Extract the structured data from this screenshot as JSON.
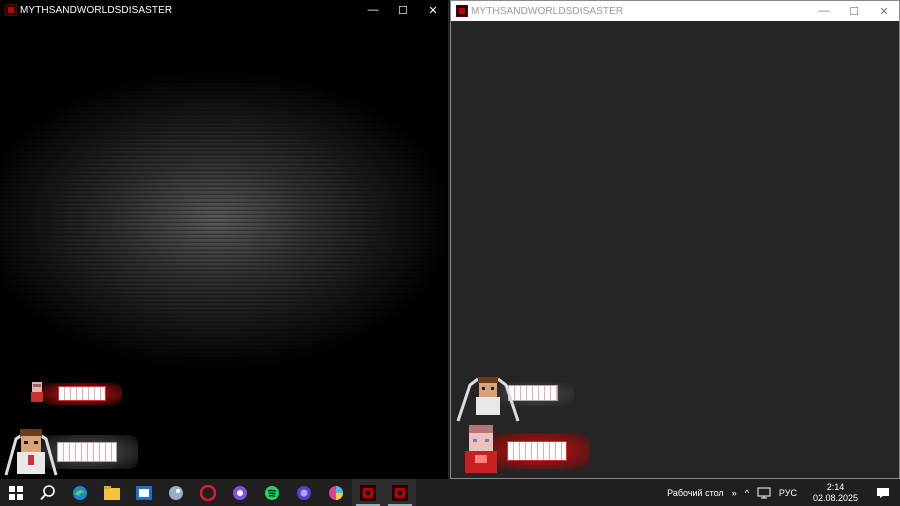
{
  "windows": {
    "left": {
      "title": "MYTHSANDWORLDSDISASTER"
    },
    "right": {
      "title": "MYTHSANDWORLDSDISASTER"
    }
  },
  "window_controls": {
    "minimize": "—",
    "maximize": "☐",
    "close": "✕"
  },
  "taskbar": {
    "apps": [
      {
        "name": "start",
        "icon": "windows-logo-icon"
      },
      {
        "name": "search",
        "icon": "search-icon"
      },
      {
        "name": "edge",
        "icon": "edge-icon"
      },
      {
        "name": "explorer",
        "icon": "folder-icon"
      },
      {
        "name": "app-blue",
        "icon": "blue-square-icon"
      },
      {
        "name": "app-bird",
        "icon": "bird-icon"
      },
      {
        "name": "opera",
        "icon": "opera-icon"
      },
      {
        "name": "app-chat",
        "icon": "chat-icon"
      },
      {
        "name": "spotify",
        "icon": "spotify-icon"
      },
      {
        "name": "app-purple",
        "icon": "purple-icon"
      },
      {
        "name": "app-color",
        "icon": "color-wheel-icon"
      },
      {
        "name": "game1",
        "icon": "game-icon"
      },
      {
        "name": "game2",
        "icon": "game-icon"
      }
    ],
    "desktop_label": "Рабочий стол",
    "chevron": "»",
    "tray_up": "^",
    "language": "РУС",
    "time": "2:14",
    "date": "02.08.2025",
    "notification": "▭"
  },
  "colors": {
    "accent_red": "#c20000",
    "taskbar": "#1f1f1f",
    "bar_red": "#8a0f0f"
  }
}
